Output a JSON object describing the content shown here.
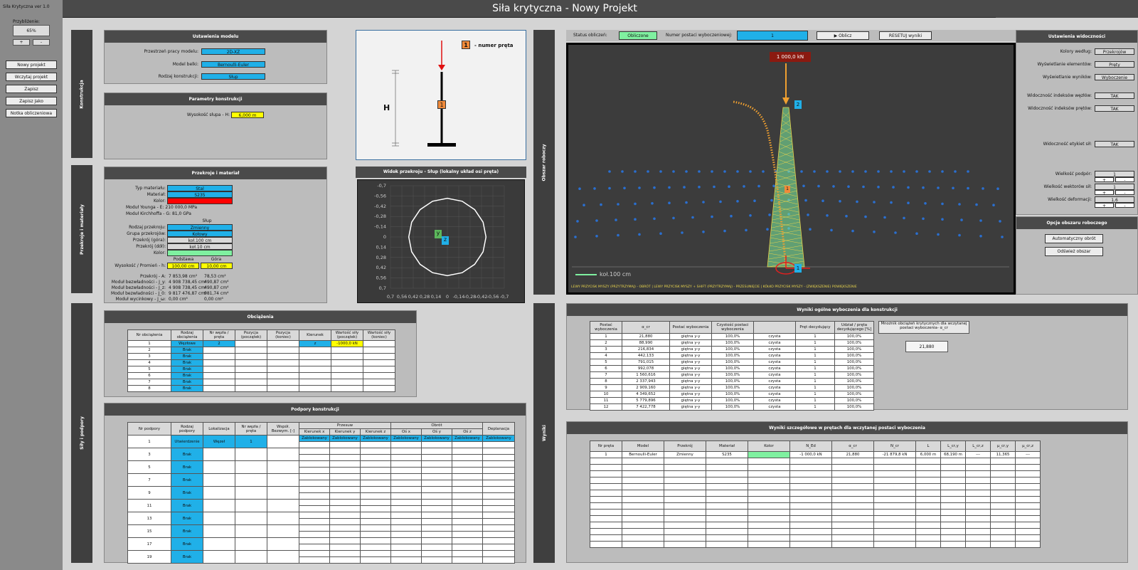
{
  "app": {
    "title": "Siła krytyczna - Nowy Projekt",
    "version": "Siła Krytyczna ver 1.0"
  },
  "left_panel": {
    "zoom_label": "Przybliżenie:",
    "zoom_value": "65%",
    "zoom_plus": "+",
    "zoom_minus": "-",
    "buttons": [
      "Nowy projekt",
      "Wczytaj projekt",
      "Zapisz",
      "Zapisz Jako",
      "Notka obliczeniowa"
    ]
  },
  "side_tabs": {
    "konstrukcja": "Konstrukcja",
    "przekroje": "Przekroje i materiały",
    "sily": "Siły i podpory",
    "obszar": "Obszar roboczy",
    "wyniki": "Wyniki"
  },
  "model_settings": {
    "header": "Ustawienia modelu",
    "rows": [
      {
        "label": "Przestrzeń pracy modelu:",
        "value": "2D-XZ"
      },
      {
        "label": "Model belki:",
        "value": "Bernoulli-Euler"
      },
      {
        "label": "Rodzaj konstrukcji:",
        "value": "Słup"
      }
    ]
  },
  "construction_params": {
    "header": "Parametry konstrukcji",
    "height_label": "Wysokość słupa - H:",
    "height_value": "6,000 m"
  },
  "schematic": {
    "legend_number": "1",
    "legend_text": "- numer pręta",
    "h_label": "H",
    "bar_label": "1"
  },
  "section_material": {
    "header": "Przekroje i materiał",
    "rows": [
      {
        "label": "Typ materiału:",
        "value": "Stal"
      },
      {
        "label": "Materiał:",
        "value": "S235"
      },
      {
        "label": "Kolor:",
        "value": ""
      }
    ],
    "young": "Moduł Younga - E: 210 000,0 MPa",
    "kirchhoff": "Moduł Kirchhoffa - G: 81,0 GPa",
    "slup_title": "Słup",
    "section_rows": [
      {
        "label": "Rodzaj przekroju:",
        "value": "Zmienny"
      },
      {
        "label": "Grupa przekrojów:",
        "value": "Kołowy"
      },
      {
        "label": "Przekrój (góra):",
        "value": "koł.100 cm"
      },
      {
        "label": "Przekrój (dół):",
        "value": "koł.10 cm"
      },
      {
        "label": "Kolor:",
        "value": ""
      }
    ],
    "col_base": "Podstawa",
    "col_top": "Góra",
    "height_label": "Wysokość / Promień - h:",
    "height_base": "100,00 cm",
    "height_top": "10,00 cm",
    "props": [
      {
        "label": "Przekrój - A:",
        "base": "7 853,98 cm²",
        "top": "78,53 cm²"
      },
      {
        "label": "Moduł bezwładności - J_y:",
        "base": "4 908 738,45 cm⁴",
        "top": "490,87 cm⁴"
      },
      {
        "label": "Moduł bezwładności - J_z:",
        "base": "4 908 738,45 cm⁴",
        "top": "490,87 cm⁴"
      },
      {
        "label": "Moduł bezwładności - J_0:",
        "base": "9 817 476,87 cm⁴",
        "top": "981,74 cm⁴"
      },
      {
        "label": "Moduł wycinkowy - J_ω:",
        "base": "0,00 cm⁶",
        "top": "0,00 cm⁶"
      }
    ]
  },
  "section_view": {
    "header": "Widok przekroju - Słup (lokalny układ osi pręta)",
    "y_ticks": [
      "-0,7",
      "-0,56",
      "-0,42",
      "-0,28",
      "-0,14",
      "0",
      "0,14",
      "0,28",
      "0,42",
      "0,56",
      "0,7"
    ],
    "x_ticks": [
      "0,7",
      "0,56",
      "0,42",
      "0,28",
      "0,14",
      "0",
      "-0,14",
      "-0,28",
      "-0,42",
      "-0,56",
      "-0,7"
    ],
    "y_axis": "y",
    "z_axis": "z"
  },
  "loads": {
    "header": "Obciążenia",
    "columns": [
      "Nr obciążenia",
      "Rodzaj obciążenia",
      "Nr węzła / pręta",
      "Pozycja (początek)",
      "Pozycja (koniec)",
      "Kierunek",
      "Wartość siły (początek)",
      "Wartość siły (koniec)"
    ],
    "rows": [
      [
        "1",
        "Węzłowe",
        "2",
        "",
        "",
        "z",
        "-1000,0 kN",
        ""
      ],
      [
        "2",
        "Brak",
        "",
        "",
        "",
        "",
        "",
        ""
      ],
      [
        "3",
        "Brak",
        "",
        "",
        "",
        "",
        "",
        ""
      ],
      [
        "4",
        "Brak",
        "",
        "",
        "",
        "",
        "",
        ""
      ],
      [
        "5",
        "Brak",
        "",
        "",
        "",
        "",
        "",
        ""
      ],
      [
        "6",
        "Brak",
        "",
        "",
        "",
        "",
        "",
        ""
      ],
      [
        "7",
        "Brak",
        "",
        "",
        "",
        "",
        "",
        ""
      ],
      [
        "8",
        "Brak",
        "",
        "",
        "",
        "",
        "",
        ""
      ]
    ]
  },
  "supports": {
    "header": "Podpory konstrukcji",
    "col_nr": "Nr podpory",
    "col_type": "Rodzaj podpory",
    "col_loc": "Lokalizacja",
    "col_node": "Nr węzła / pręta",
    "col_coef": "Współ. Bezwym. [-]",
    "col_przesuw": "Przesuw",
    "col_obrot": "Obrót",
    "col_depl": "Deplanacja",
    "sub": [
      "Kierunek x",
      "Kierunek y",
      "Kierunek z",
      "Oś x",
      "Oś y",
      "Oś z"
    ],
    "rows": [
      {
        "nr": "1",
        "type": "Utwierdzenie",
        "loc": "Węzeł",
        "node": "1",
        "vals": [
          "Zablokowany",
          "Zablokowany",
          "Zablokowany",
          "Zablokowany",
          "Zablokowany",
          "Zablokowany",
          "Zablokowany"
        ]
      },
      {
        "nr": "3",
        "type": "Brak"
      },
      {
        "nr": "5",
        "type": "Brak"
      },
      {
        "nr": "7",
        "type": "Brak"
      },
      {
        "nr": "9",
        "type": "Brak"
      },
      {
        "nr": "11",
        "type": "Brak"
      },
      {
        "nr": "13",
        "type": "Brak"
      },
      {
        "nr": "15",
        "type": "Brak"
      },
      {
        "nr": "17",
        "type": "Brak"
      },
      {
        "nr": "19",
        "type": "Brak"
      }
    ]
  },
  "viewport_bar": {
    "status_label": "Status obliczeń:",
    "status_value": "Obliczone",
    "mode_label": "Numer postaci wyboczeniowej:",
    "mode_value": "1",
    "calc_button": "▶ Oblicz",
    "reset_button": "RESETUJ wyniki"
  },
  "viewport": {
    "force_label": "1 000,0 kN",
    "node_top": "2",
    "node_bottom": "1",
    "bar_mid": "1",
    "legend": "koł.100 cm",
    "hint": "LEWY PRZYCISK MYSZY (PRZYTRZYMAJ) - OBRÓT   |   LEWY PRZYCISK MYSZY + SHIFT (PRZYTRZYMAJ) - PRZESUNIĘCIE   |   KÓŁKO PRZYCISK MYSZY - (ZWIĘKSZENIE) POWIĘKSZENIE"
  },
  "view_settings": {
    "header": "Ustawienia widoczności",
    "rows": [
      {
        "label": "Kolory według:",
        "value": "Przekrojów"
      },
      {
        "label": "Wyświetlanie elementów:",
        "value": "Pręty"
      },
      {
        "label": "Wyświetlanie wyników:",
        "value": "Wyboczenie"
      },
      {
        "label": "Widoczność indeksów węzłów:",
        "value": "TAK"
      },
      {
        "label": "Widoczność indeksów prętów:",
        "value": "TAK"
      },
      {
        "label": "Widoczność etykiet sił:",
        "value": "TAK"
      },
      {
        "label": "Wielkość podpór:",
        "value": "1"
      },
      {
        "label": "Wielkość wektorów sił:",
        "value": "1"
      },
      {
        "label": "Wielkość deformacji:",
        "value": "1,6"
      }
    ],
    "plus": "+",
    "minus": "-",
    "options_header": "Opcje obszaru roboczego",
    "auto_rotate": "Automatyczny obrót",
    "refresh": "Odśwież obszar"
  },
  "results_general": {
    "header": "Wyniki ogólne wyboczenia dla konstrukcji",
    "columns": [
      "Postać wyboczenia",
      "α_cr",
      "Postać wyboczenia",
      "Czystość postaci wyboczenia",
      "",
      "Pręt decydujący",
      "Udział / pręta decydującego [%]"
    ],
    "rows": [
      [
        "1",
        "21,880",
        "giętna y-y",
        "100,0%",
        "czysta",
        "1",
        "100,0%"
      ],
      [
        "2",
        "88,990",
        "giętna y-y",
        "100,0%",
        "czysta",
        "1",
        "100,0%"
      ],
      [
        "3",
        "216,834",
        "giętna y-y",
        "100,0%",
        "czysta",
        "1",
        "100,0%"
      ],
      [
        "4",
        "442,133",
        "giętna y-y",
        "100,0%",
        "czysta",
        "1",
        "100,0%"
      ],
      [
        "5",
        "791,015",
        "giętna y-y",
        "100,0%",
        "czysta",
        "1",
        "100,0%"
      ],
      [
        "6",
        "992,078",
        "giętna y-y",
        "100,0%",
        "czysta",
        "1",
        "100,0%"
      ],
      [
        "7",
        "1 560,616",
        "giętna y-y",
        "100,0%",
        "czysta",
        "1",
        "100,0%"
      ],
      [
        "8",
        "2 337,943",
        "giętna y-y",
        "100,0%",
        "czysta",
        "1",
        "100,0%"
      ],
      [
        "9",
        "2 909,160",
        "giętna y-y",
        "100,0%",
        "czysta",
        "1",
        "100,0%"
      ],
      [
        "10",
        "4 349,652",
        "giętna y-y",
        "100,0%",
        "czysta",
        "1",
        "100,0%"
      ],
      [
        "11",
        "5 779,896",
        "giętna y-y",
        "100,0%",
        "czysta",
        "1",
        "100,0%"
      ],
      [
        "12",
        "7 422,778",
        "giętna y-y",
        "100,0%",
        "czysta",
        "1",
        "100,0%"
      ]
    ],
    "multiplier_label": "Mnożnik obciążeń krytycznych dla wczytanej postaci wyboczenia- α_cr",
    "multiplier_value": "21,880"
  },
  "results_detail": {
    "header": "Wyniki szczegółowe w prętach dla wczytanej postaci wyboczenia",
    "columns": [
      "Nr pręta",
      "Model",
      "Przekrój",
      "Materiał",
      "Kolor",
      "N_Ed",
      "α_cr",
      "N_cr",
      "L",
      "L_cr,y",
      "L_cr,z",
      "μ_cr,y",
      "μ_cr,z"
    ],
    "row": [
      "1",
      "Bernoulli-Euler",
      "Zmienny",
      "S235",
      "",
      "-1 000,0 kN",
      "21,880",
      "-21 879,8 kN",
      "6,000 m",
      "68,190 m",
      "---",
      "11,365",
      "---"
    ]
  },
  "colors": {
    "accent_cyan": "#20b0e8",
    "yellow": "#ffff00",
    "red": "#ff0000",
    "green": "#7ff0a0",
    "viewport_bg": "#3c3c3c"
  }
}
